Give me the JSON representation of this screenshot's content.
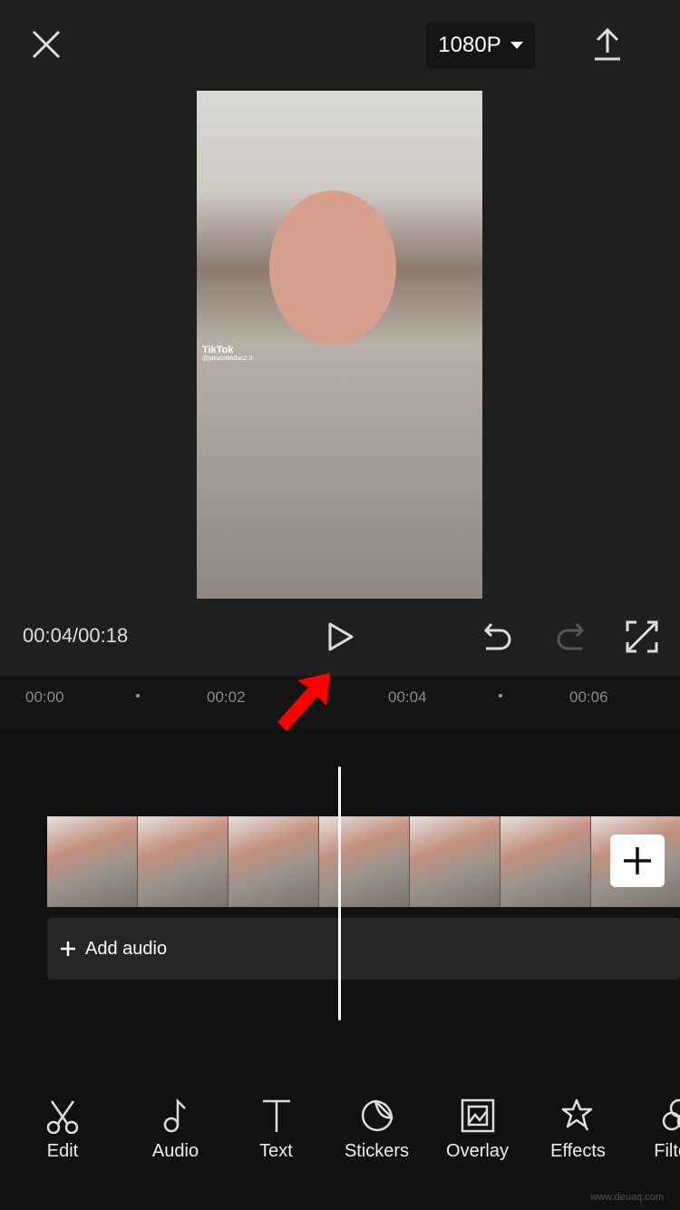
{
  "header": {
    "resolution": "1080P",
    "close_icon": "close-icon",
    "export_icon": "upload-icon"
  },
  "preview": {
    "watermark_brand": "TikTok",
    "watermark_user": "@jabaistiddlas2.0"
  },
  "player": {
    "time": "00:04/00:18"
  },
  "ruler": {
    "ticks": [
      "00:00",
      "00:02",
      "00:04",
      "00:06"
    ]
  },
  "timeline": {
    "add_audio": "Add audio",
    "frame_count": 7
  },
  "toolbar": {
    "items": [
      {
        "label": "Edit",
        "icon": "scissors-icon"
      },
      {
        "label": "Audio",
        "icon": "music-note-icon"
      },
      {
        "label": "Text",
        "icon": "text-icon"
      },
      {
        "label": "Stickers",
        "icon": "sticker-icon"
      },
      {
        "label": "Overlay",
        "icon": "overlay-icon"
      },
      {
        "label": "Effects",
        "icon": "star-wand-icon"
      },
      {
        "label": "Filters",
        "icon": "filters-icon"
      }
    ]
  },
  "site_watermark": "www.deuaq.com",
  "colors": {
    "annotation_arrow": "#ff0000",
    "background": "#1f1f1f"
  }
}
